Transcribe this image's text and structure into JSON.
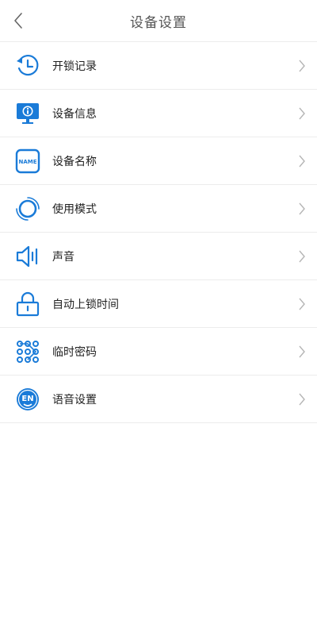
{
  "header": {
    "title": "设备设置"
  },
  "menu": [
    {
      "label": "开锁记录",
      "icon": "history-icon"
    },
    {
      "label": "设备信息",
      "icon": "info-monitor-icon"
    },
    {
      "label": "设备名称",
      "icon": "name-tag-icon"
    },
    {
      "label": "使用模式",
      "icon": "ring-mode-icon"
    },
    {
      "label": "声音",
      "icon": "speaker-icon"
    },
    {
      "label": "自动上锁时间",
      "icon": "lock-icon"
    },
    {
      "label": "临时密码",
      "icon": "keypad-dots-icon"
    },
    {
      "label": "语音设置",
      "icon": "language-en-icon"
    }
  ],
  "colors": {
    "accent": "#1a7bd8",
    "divider": "#ececec",
    "chevron": "#b5b5b5"
  }
}
